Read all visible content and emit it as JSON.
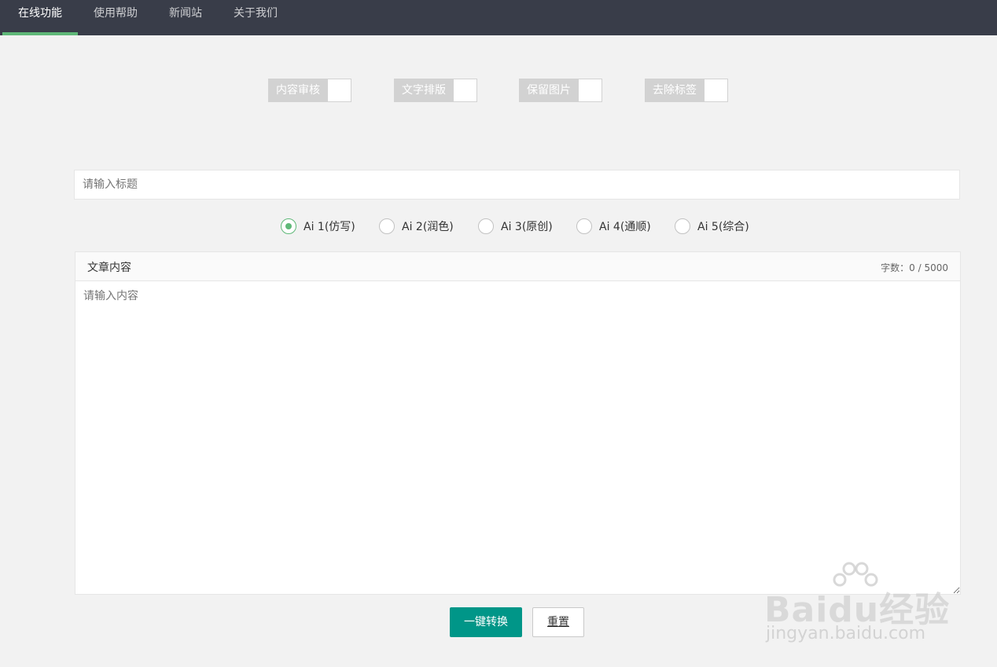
{
  "nav": {
    "items": [
      {
        "label": "在线功能",
        "active": true
      },
      {
        "label": "使用帮助",
        "active": false
      },
      {
        "label": "新闻站",
        "active": false
      },
      {
        "label": "关于我们",
        "active": false
      }
    ]
  },
  "switches": [
    {
      "label": "内容审核",
      "on": false
    },
    {
      "label": "文字排版",
      "on": false
    },
    {
      "label": "保留图片",
      "on": false
    },
    {
      "label": "去除标签",
      "on": false
    }
  ],
  "title_input": {
    "placeholder": "请输入标题",
    "value": ""
  },
  "ai_options": [
    {
      "label": "Ai 1(仿写)",
      "checked": true
    },
    {
      "label": "Ai 2(润色)",
      "checked": false
    },
    {
      "label": "Ai 3(原创)",
      "checked": false
    },
    {
      "label": "Ai 4(通顺)",
      "checked": false
    },
    {
      "label": "Ai 5(综合)",
      "checked": false
    }
  ],
  "editor": {
    "title": "文章内容",
    "word_count": "字数：0 / 5000",
    "placeholder": "请输入内容",
    "value": ""
  },
  "buttons": {
    "convert": "一键转换",
    "reset": "重置"
  },
  "watermark": {
    "logo": "Baidu经验",
    "url": "jingyan.baidu.com"
  },
  "colors": {
    "nav_bg": "#393d49",
    "nav_active_bar": "#5fb878",
    "primary_button": "#009688",
    "switch_off": "#d2d2d2",
    "radio_checked": "#5fb878"
  }
}
